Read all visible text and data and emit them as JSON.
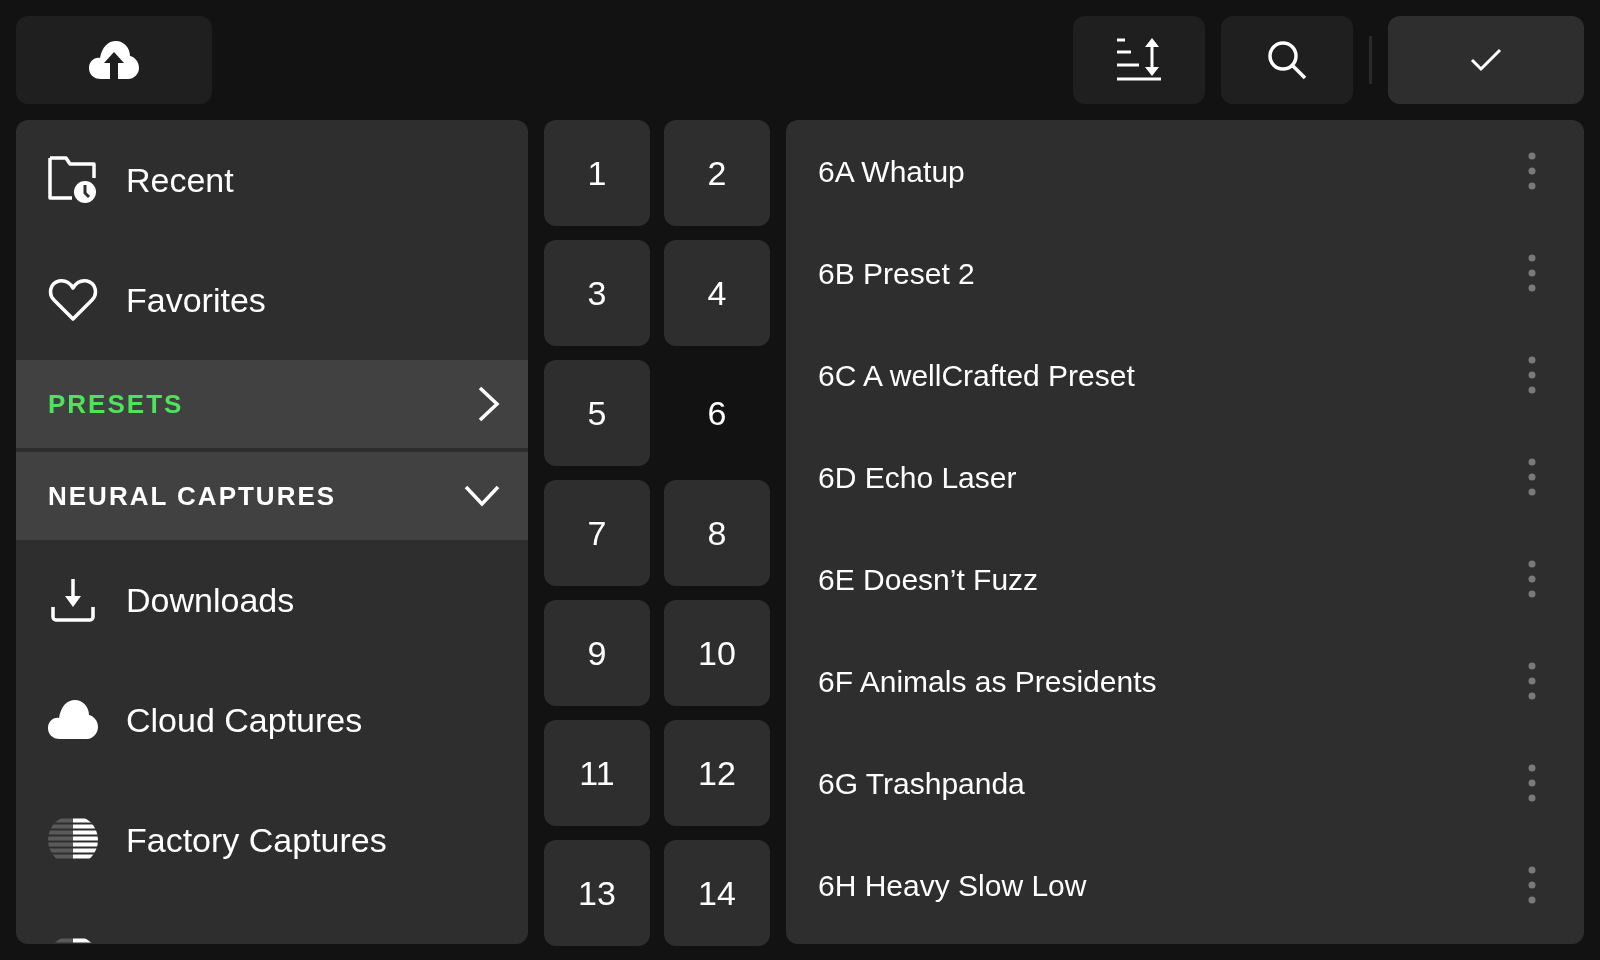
{
  "sidebar": {
    "top_items": [
      {
        "kind": "recent",
        "label": "Recent"
      },
      {
        "kind": "favorites",
        "label": "Favorites"
      }
    ],
    "sections": [
      {
        "label": "PRESETS",
        "selected": true,
        "expanded": false
      },
      {
        "label": "NEURAL CAPTURES",
        "selected": false,
        "expanded": true
      }
    ],
    "capture_items": [
      {
        "kind": "downloads",
        "label": "Downloads"
      },
      {
        "kind": "cloud",
        "label": "Cloud Captures"
      },
      {
        "kind": "factory",
        "label": "Factory Captures"
      },
      {
        "kind": "factory"
      }
    ]
  },
  "banks": [
    {
      "label": "1",
      "selected": false
    },
    {
      "label": "2",
      "selected": false
    },
    {
      "label": "3",
      "selected": false
    },
    {
      "label": "4",
      "selected": false
    },
    {
      "label": "5",
      "selected": false
    },
    {
      "label": "6",
      "selected": true
    },
    {
      "label": "7",
      "selected": false
    },
    {
      "label": "8",
      "selected": false
    },
    {
      "label": "9",
      "selected": false
    },
    {
      "label": "10",
      "selected": false
    },
    {
      "label": "11",
      "selected": false
    },
    {
      "label": "12",
      "selected": false
    },
    {
      "label": "13",
      "selected": false
    },
    {
      "label": "14",
      "selected": false
    }
  ],
  "presets": [
    {
      "name": "6A Whatup"
    },
    {
      "name": "6B Preset 2"
    },
    {
      "name": "6C A wellCrafted Preset"
    },
    {
      "name": "6D Echo Laser"
    },
    {
      "name": "6E Doesn’t Fuzz"
    },
    {
      "name": "6F Animals as Presidents"
    },
    {
      "name": "6G Trashpanda"
    },
    {
      "name": "6H Heavy Slow Low"
    }
  ]
}
